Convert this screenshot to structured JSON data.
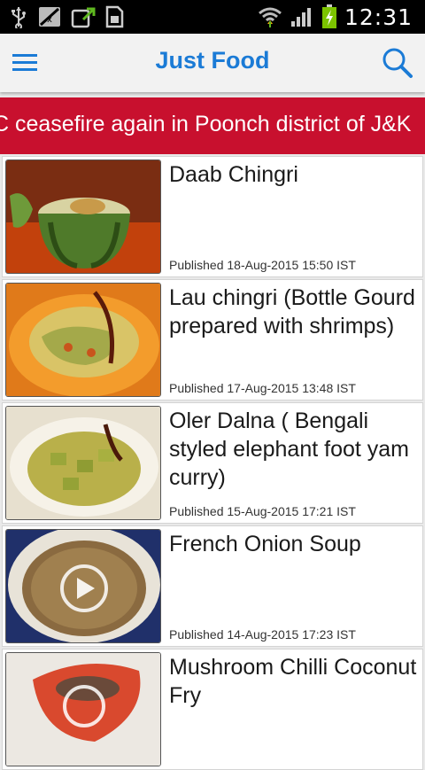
{
  "status_bar": {
    "time": "12:31",
    "icons": [
      "usb-icon",
      "no-sim-icon",
      "upload-icon",
      "sd-card-icon",
      "wifi-icon",
      "signal-icon",
      "battery-charging-icon"
    ]
  },
  "app_bar": {
    "title": "Just Food",
    "menu_icon": "hamburger-menu-icon",
    "search_icon": "search-icon"
  },
  "ticker": {
    "text": "C ceasefire again in Poonch district of J&K"
  },
  "articles": [
    {
      "title": "Daab Chingri",
      "published": "Published 18-Aug-2015 15:50 IST",
      "has_video": false
    },
    {
      "title": "Lau chingri (Bottle Gourd prepared with shrimps)",
      "published": "Published 17-Aug-2015 13:48 IST",
      "has_video": false
    },
    {
      "title": "Oler Dalna ( Bengali styled elephant foot yam curry)",
      "published": "Published 15-Aug-2015 17:21 IST",
      "has_video": false
    },
    {
      "title": "French Onion Soup",
      "published": "Published 14-Aug-2015 17:23 IST",
      "has_video": true
    },
    {
      "title": "Mushroom Chilli Coconut Fry",
      "published": "",
      "has_video": true
    }
  ],
  "colors": {
    "accent": "#1b7bd6",
    "ticker_bg": "#c8102e",
    "status_bar_bg": "#000000",
    "battery_green": "#7cc400"
  }
}
